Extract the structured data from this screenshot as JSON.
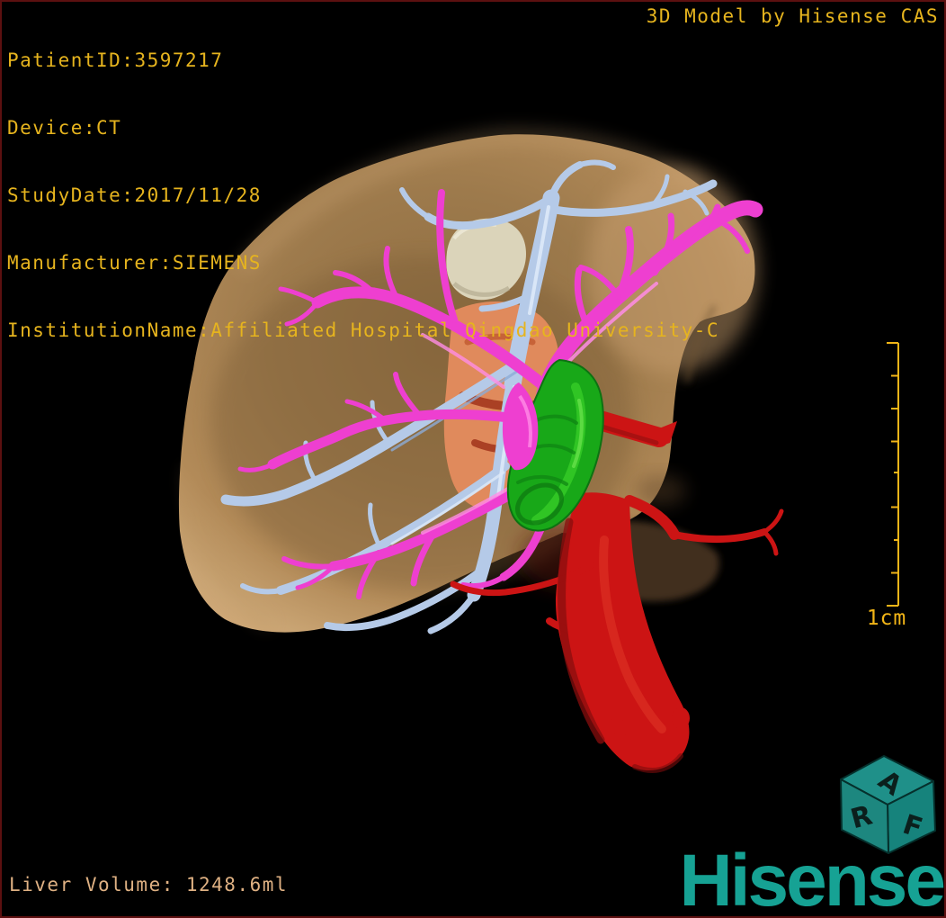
{
  "overlay": {
    "patient_fields": [
      {
        "label": "PatientID:",
        "value": "3597217"
      },
      {
        "label": "Device:",
        "value": "CT"
      },
      {
        "label": "StudyDate:",
        "value": "2017/11/28"
      },
      {
        "label": "Manufacturer:",
        "value": "SIEMENS"
      },
      {
        "label": "InstitutionName:",
        "value": "Affiliated Hospital Qingdao University-C"
      }
    ],
    "watermark": "3D Model by Hisense CAS",
    "volume_label": "Liver Volume:",
    "volume_value": "1248.6ml",
    "scale_label": "1cm"
  },
  "branding": {
    "logo_text": "Hisense"
  },
  "orientation_cube": {
    "letters": [
      "R",
      "A",
      "F"
    ]
  },
  "colors": {
    "background": "#000000",
    "frame_border": "#5c1010",
    "overlay_text": "#e6b41e",
    "volume_text": "#dfb183",
    "scale_bar": "#f2b517",
    "brand_teal": "#16a294",
    "cube_teal": "#1f8d86",
    "liver": "#a5804f",
    "portal_vein": "#ee3fd0",
    "portal_highlight": "#ff8ce6",
    "hepatic_vein": "#b5cae8",
    "hepatic_artery": "#cc1414",
    "gallbladder": "#18a818",
    "lesion": "#dbd4ba",
    "ivc": "#e08a5c"
  }
}
